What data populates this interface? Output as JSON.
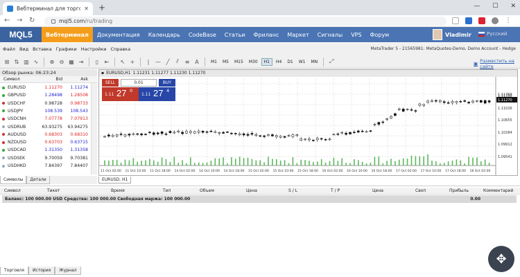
{
  "browser": {
    "tab_title": "Вебтерминал для торговой пла",
    "url_domain": "mql5.com",
    "url_path": "/ru/trading"
  },
  "mql": {
    "logo": "MQL5",
    "nav": [
      "Вебтерминал",
      "Документация",
      "Календарь",
      "CodeBase",
      "Статьи",
      "Фриланс",
      "Маркет",
      "Сигналы",
      "VPS",
      "Форум"
    ],
    "user": "Vladimir",
    "lang": "Русский"
  },
  "terminal": {
    "menu": [
      "Файл",
      "Вид",
      "Вставка",
      "Графики",
      "Настройки",
      "Справка"
    ],
    "account": "MetaTrader 5 - 21565981: MetaQuotes-Demo, Demo Account - Hedge",
    "timeframes": [
      "M1",
      "M5",
      "M15",
      "M30",
      "H1",
      "H4",
      "D1",
      "W1",
      "MN"
    ],
    "active_tf": "H1",
    "signal_link": "Разместить на сайте"
  },
  "market_watch": {
    "title": "Обзор рынка: 06:23:24",
    "col_symbol": "Символ",
    "col_bid": "Bid",
    "col_ask": "Ask",
    "rows": [
      {
        "sym": "EURUSD",
        "bid": "1.11270",
        "ask": "1.11274",
        "bidc": "#d22",
        "askc": "#22c",
        "dot": "#3a3"
      },
      {
        "sym": "GBPUSD",
        "bid": "1.28498",
        "ask": "1.28508",
        "bidc": "#22c",
        "askc": "#d22",
        "dot": "#3a3"
      },
      {
        "sym": "USDCHF",
        "bid": "0.98728",
        "ask": "0.98733",
        "bidc": "#222",
        "askc": "#d22",
        "dot": "#c33"
      },
      {
        "sym": "USDJPY",
        "bid": "108.539",
        "ask": "108.543",
        "bidc": "#22c",
        "askc": "#22c",
        "dot": "#3a3"
      },
      {
        "sym": "USDCNH",
        "bid": "7.07778",
        "ask": "7.07913",
        "bidc": "#d22",
        "askc": "#d22",
        "dot": "#c33"
      },
      {
        "sym": "USDRUB",
        "bid": "63.93275",
        "ask": "63.94275",
        "bidc": "#222",
        "askc": "#222",
        "dot": "#9ab"
      },
      {
        "sym": "AUDUSD",
        "bid": "0.68303",
        "ask": "0.68310",
        "bidc": "#d22",
        "askc": "#d22",
        "dot": "#c33"
      },
      {
        "sym": "NZDUSD",
        "bid": "0.63703",
        "ask": "0.63715",
        "bidc": "#d22",
        "askc": "#22c",
        "dot": "#c33"
      },
      {
        "sym": "USDCAD",
        "bid": "1.31350",
        "ask": "1.31358",
        "bidc": "#22c",
        "askc": "#22c",
        "dot": "#3a3"
      },
      {
        "sym": "USDSEK",
        "bid": "9.70059",
        "ask": "9.70381",
        "bidc": "#222",
        "askc": "#222",
        "dot": "#9ab"
      },
      {
        "sym": "USDHKD",
        "bid": "7.84397",
        "ask": "7.84407",
        "bidc": "#222",
        "askc": "#222",
        "dot": "#9ab"
      }
    ],
    "tabs": [
      "Символы",
      "Детали"
    ]
  },
  "chart": {
    "header": "EURUSD,H1",
    "ohlc": "1.11231 1.11277 1.11230 1.11270",
    "sell_label": "SELL",
    "buy_label": "BUY",
    "lot": "0.01",
    "sell_small": "1.11",
    "sell_big": "27",
    "sell_sup": "0",
    "buy_small": "1.11",
    "buy_big": "27",
    "buy_sup": "4",
    "price_labels": [
      "1.11769",
      "1.11398",
      "1.11270",
      "1.11026",
      "1.10655",
      "1.10284",
      "1.09912",
      "1.09541"
    ],
    "current_price": "1.11270",
    "time_labels": [
      "11 Oct 02:00",
      "11 Oct 10:00",
      "11 Oct 18:00",
      "14 Oct 02:00",
      "14 Oct 10:00",
      "14 Oct 18:00",
      "15 Oct 02:00",
      "15 Oct 10:00",
      "15 Oct 18:00",
      "16 Oct 02:00",
      "16 Oct 10:00",
      "16 Oct 18:00",
      "17 Oct 02:00",
      "17 Oct 10:00",
      "17 Oct 18:00",
      "18 Oct 02:00"
    ],
    "tab": "EURUSD, H1"
  },
  "trade": {
    "cols": [
      "Символ",
      "Тикет",
      "Время",
      "Тип",
      "Объем",
      "Цена",
      "S / L",
      "T / P",
      "Цена",
      "Своп",
      "Прибыль",
      "Комментарий"
    ],
    "balance_text": "Баланс: 100 000.00 USD  Средства: 100 000.00  Свободная маржа: 100 000.00",
    "profit": "0.00",
    "tabs": [
      "Торговля",
      "История",
      "Журнал"
    ]
  }
}
